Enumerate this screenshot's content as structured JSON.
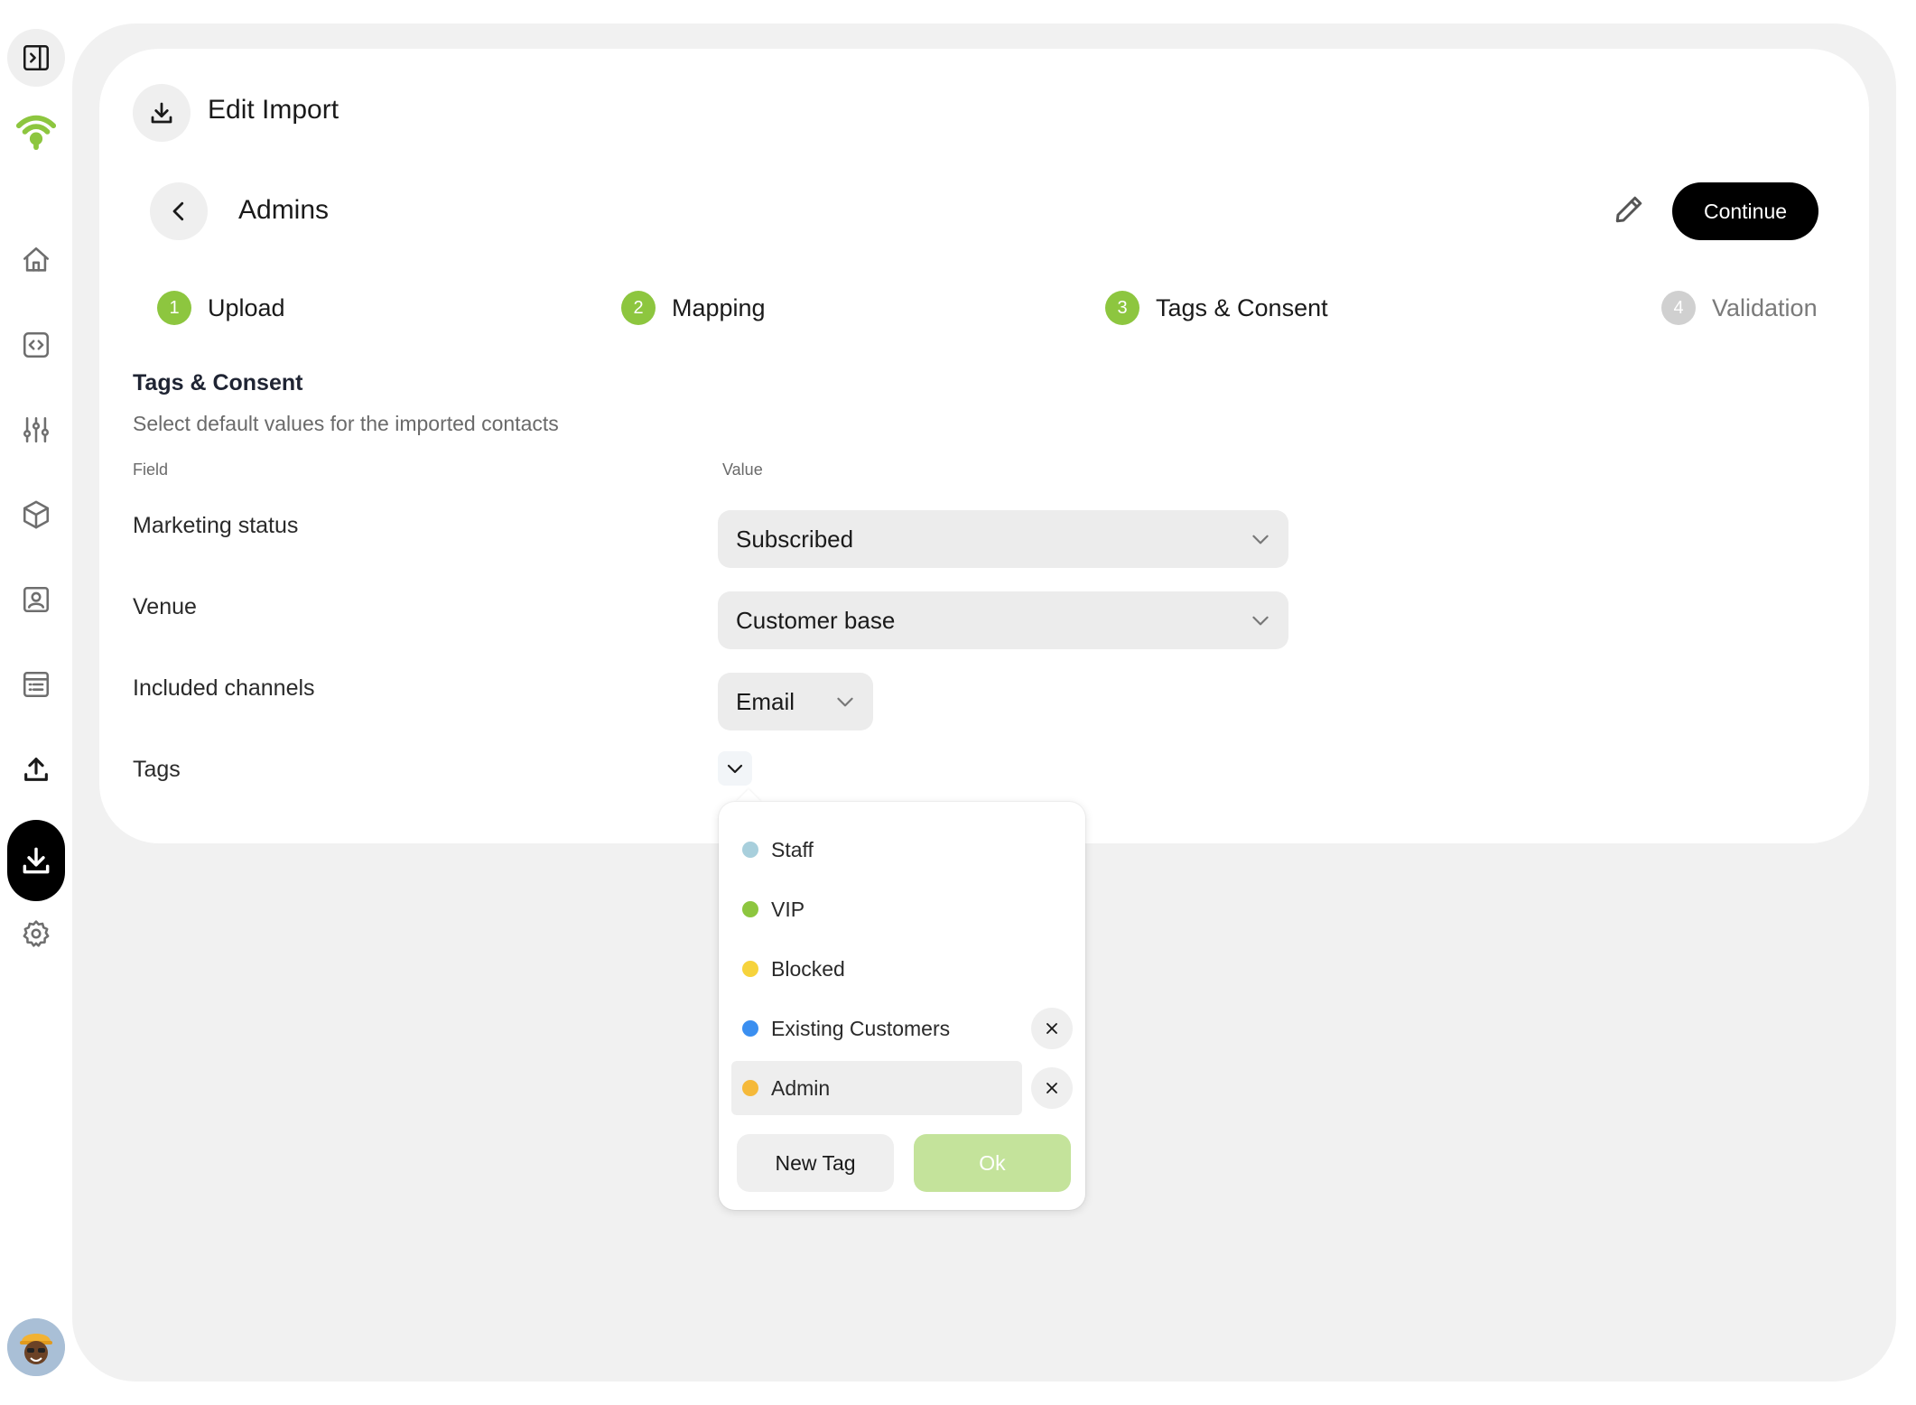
{
  "sidebar": {
    "items": [
      {
        "icon": "panel-toggle-icon"
      },
      {
        "icon": "wifi-logo-icon",
        "color": "#8dc63f"
      },
      {
        "icon": "home-icon"
      },
      {
        "icon": "code-icon"
      },
      {
        "icon": "sliders-icon"
      },
      {
        "icon": "box-icon"
      },
      {
        "icon": "contact-card-icon"
      },
      {
        "icon": "list-icon"
      },
      {
        "icon": "upload-icon"
      },
      {
        "icon": "download-icon",
        "active": true
      },
      {
        "icon": "gear-icon"
      }
    ]
  },
  "header": {
    "title": "Edit Import",
    "subtitle": "Admins",
    "continue_label": "Continue"
  },
  "steps": [
    {
      "num": "1",
      "label": "Upload",
      "status": "done"
    },
    {
      "num": "2",
      "label": "Mapping",
      "status": "done"
    },
    {
      "num": "3",
      "label": "Tags & Consent",
      "status": "current"
    },
    {
      "num": "4",
      "label": "Validation",
      "status": "pending"
    }
  ],
  "section": {
    "title": "Tags & Consent",
    "subtitle": "Select default values for the imported contacts",
    "col_field": "Field",
    "col_value": "Value"
  },
  "fields": {
    "marketing_status": {
      "label": "Marketing status",
      "value": "Subscribed"
    },
    "venue": {
      "label": "Venue",
      "value": "Customer base"
    },
    "channels": {
      "label": "Included channels",
      "value": "Email"
    },
    "tags": {
      "label": "Tags"
    }
  },
  "tags_dropdown": {
    "items": [
      {
        "name": "Staff",
        "color": "#a8cfdc",
        "removable": false,
        "selected": false
      },
      {
        "name": "VIP",
        "color": "#8dc63f",
        "removable": false,
        "selected": false
      },
      {
        "name": "Blocked",
        "color": "#f6d33c",
        "removable": false,
        "selected": false
      },
      {
        "name": "Existing Customers",
        "color": "#3b8ff0",
        "removable": true,
        "selected": false
      },
      {
        "name": "Admin",
        "color": "#f5b93a",
        "removable": true,
        "selected": true
      }
    ],
    "new_tag_label": "New Tag",
    "ok_label": "Ok"
  },
  "colors": {
    "accent": "#8dc63f",
    "ok_disabled": "#c4e39b",
    "primary_button": "#000000"
  }
}
